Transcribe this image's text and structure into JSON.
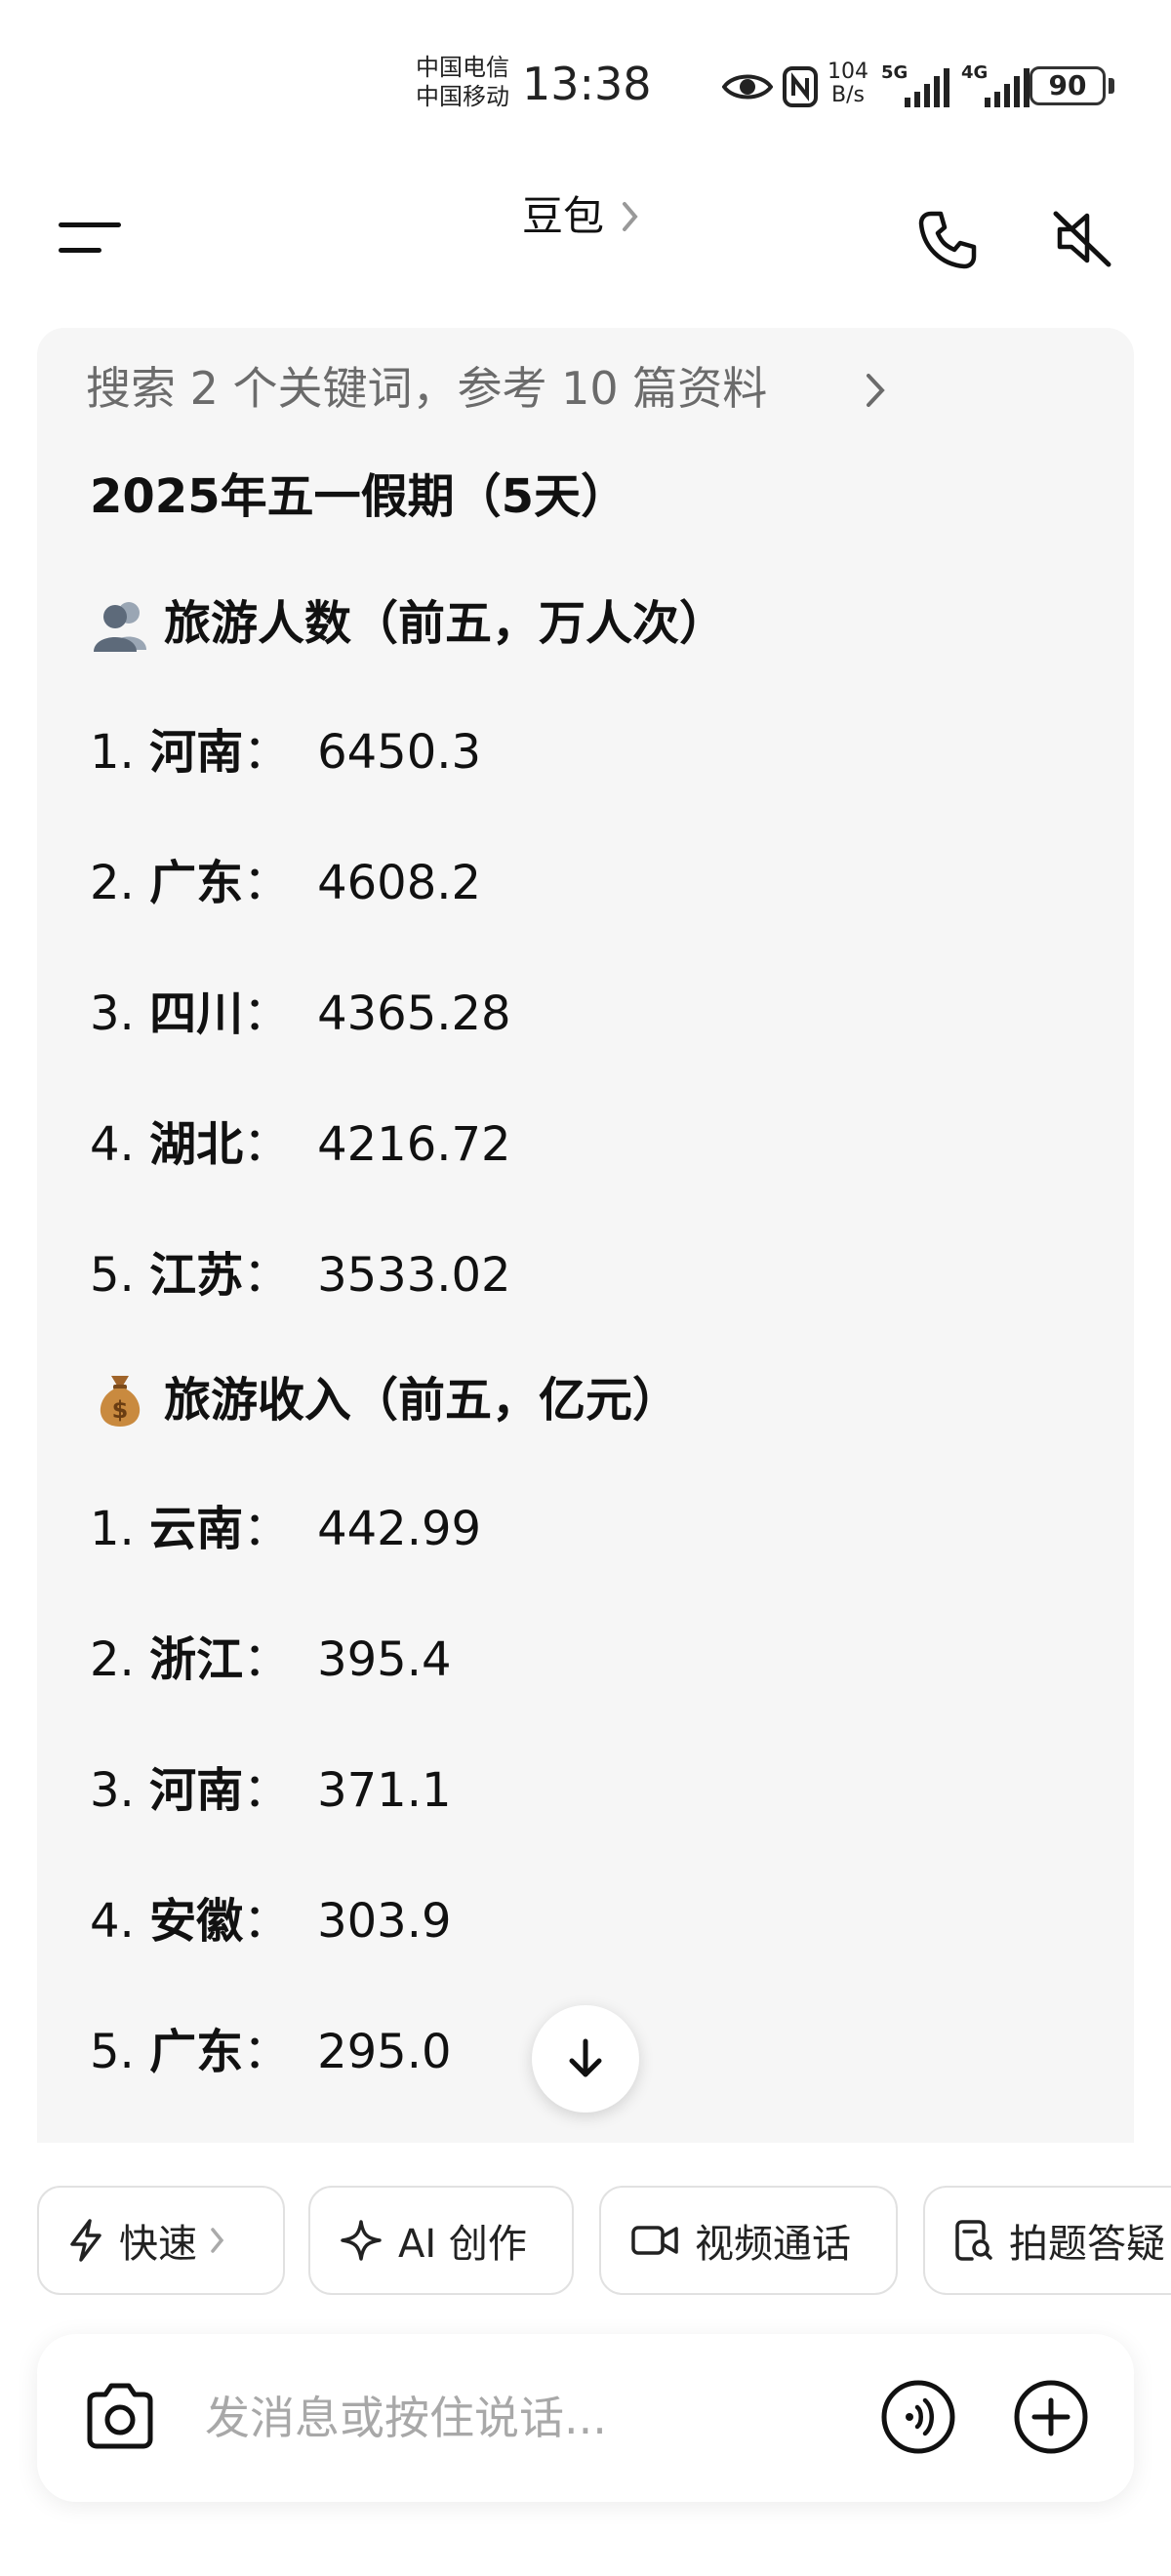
{
  "status_bar": {
    "carrier_1": "中国电信",
    "carrier_2": "中国移动",
    "time": "13:38",
    "speed_value": "104",
    "speed_unit": "B/s",
    "net_1": "5G",
    "net_2": "4G",
    "battery": "90"
  },
  "header": {
    "title": "豆包"
  },
  "answer": {
    "search_reference": "搜索 2 个关键词，参考 10 篇资料",
    "title": "2025年五一假期（5天）",
    "sections": [
      {
        "icon": "people-silhouette-icon",
        "heading": "旅游人数（前五，万人次）",
        "items": [
          {
            "num": "1.",
            "place": "河南",
            "value": "6450.3"
          },
          {
            "num": "2.",
            "place": "广东",
            "value": "4608.2"
          },
          {
            "num": "3.",
            "place": "四川",
            "value": "4365.28"
          },
          {
            "num": "4.",
            "place": "湖北",
            "value": "4216.72"
          },
          {
            "num": "5.",
            "place": "江苏",
            "value": "3533.02"
          }
        ]
      },
      {
        "icon": "money-bag-icon",
        "heading": "旅游收入（前五，亿元）",
        "items": [
          {
            "num": "1.",
            "place": "云南",
            "value": "442.99"
          },
          {
            "num": "2.",
            "place": "浙江",
            "value": "395.4"
          },
          {
            "num": "3.",
            "place": "河南",
            "value": "371.1"
          },
          {
            "num": "4.",
            "place": "安徽",
            "value": "303.9"
          },
          {
            "num": "5.",
            "place": "广东",
            "value": "295.0"
          }
        ]
      }
    ],
    "colon": "："
  },
  "quick_actions": [
    {
      "label": "快速",
      "icon": "lightning-icon"
    },
    {
      "label": "AI 创作",
      "icon": "sparkle-icon"
    },
    {
      "label": "视频通话",
      "icon": "video-camera-icon"
    },
    {
      "label": "拍题答疑",
      "icon": "document-search-icon"
    }
  ],
  "input": {
    "placeholder": "发消息或按住说话..."
  },
  "colors": {
    "card_bg": "#f6f6f6",
    "text_primary": "#111111",
    "text_secondary": "#6b6b6b",
    "placeholder": "#a8a8a8"
  }
}
